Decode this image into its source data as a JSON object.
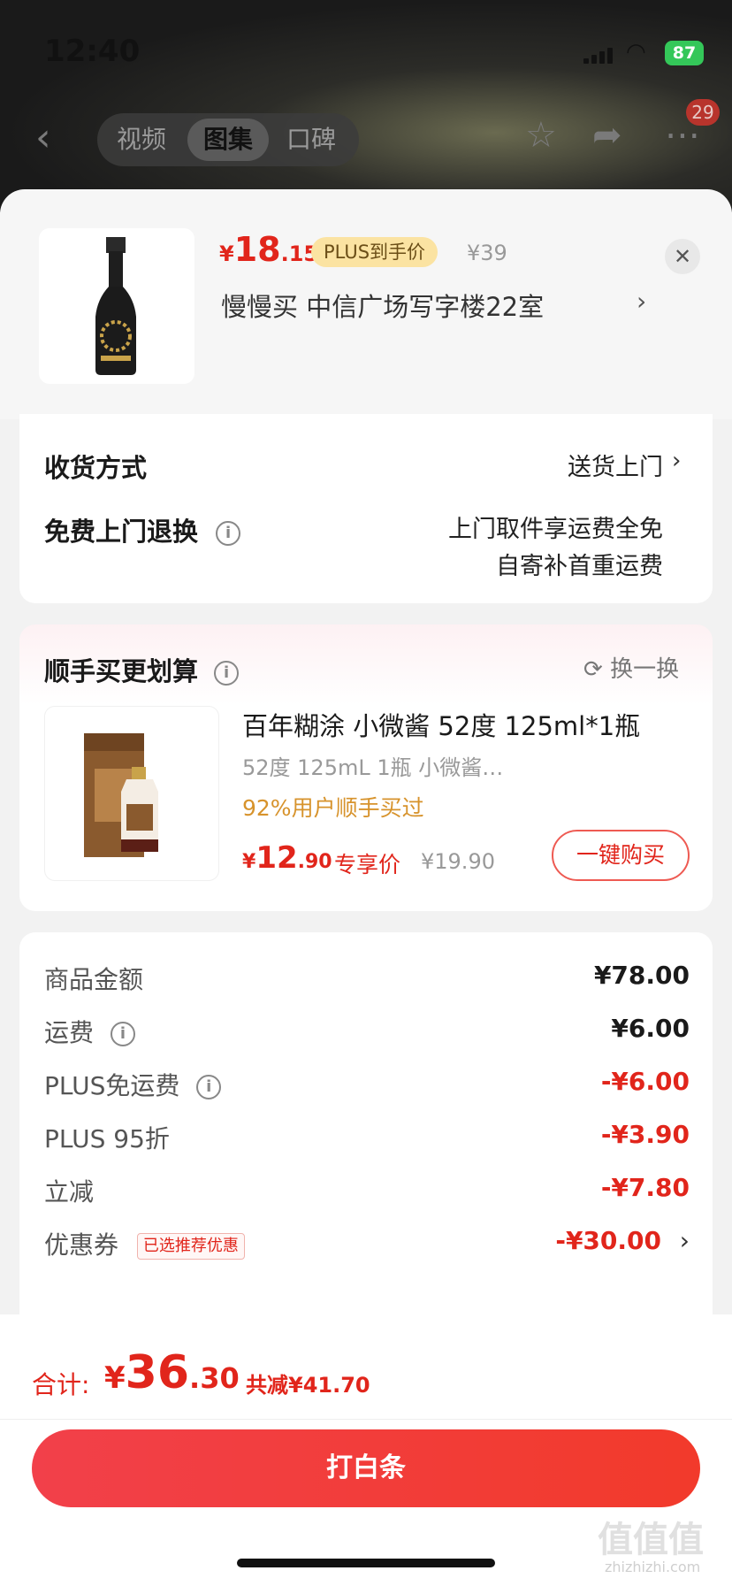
{
  "status": {
    "time": "12:40",
    "battery": "87"
  },
  "nav": {
    "tabs": [
      {
        "label": "视频"
      },
      {
        "label": "图集"
      },
      {
        "label": "口碑"
      }
    ],
    "cart_badge": "29"
  },
  "product": {
    "price_symbol": "¥",
    "price_int": "18",
    "price_dec": ".15",
    "plus_tag": "PLUS到手价",
    "old_price": "¥39",
    "address": "慢慢买  中信广场写字楼22室"
  },
  "delivery": {
    "method_label": "收货方式",
    "method_value": "送货上门",
    "return_label": "免费上门退换",
    "return_line1": "上门取件享运费全免",
    "return_line2": "自寄补首重运费"
  },
  "addon": {
    "title": "顺手买更划算",
    "refresh": "换一换",
    "name": "百年糊涂 小微酱 52度 125ml*1瓶",
    "spec": "52度 125mL 1瓶 小微酱…",
    "pct": "92%用户顺手买过",
    "price_symbol": "¥",
    "price_int": "12",
    "price_dec": ".90",
    "exclusive": "专享价",
    "old_price": "¥19.90",
    "buy_label": "一键购买"
  },
  "fees": [
    {
      "label": "商品金额",
      "amount": "¥78.00"
    },
    {
      "label": "运费",
      "amount": "¥6.00"
    },
    {
      "label": "PLUS免运费",
      "amount": "-¥6.00"
    },
    {
      "label": "PLUS 95折",
      "amount": "-¥3.90"
    },
    {
      "label": "立减",
      "amount": "-¥7.80"
    },
    {
      "label": "优惠券",
      "amount": "-¥30.00",
      "tag": "已选推荐优惠"
    }
  ],
  "total": {
    "label": "合计:",
    "symbol": "¥",
    "int": "36",
    "dec": ".30",
    "save": "共减¥41.70",
    "pay_label": "打白条"
  },
  "watermark": {
    "main": "值值值",
    "sub": "zhizhizhi.com"
  },
  "colors": {
    "accent": "#e1251b",
    "plus_tag_bg": "#fbe3a2",
    "button": "#f23a2b"
  }
}
